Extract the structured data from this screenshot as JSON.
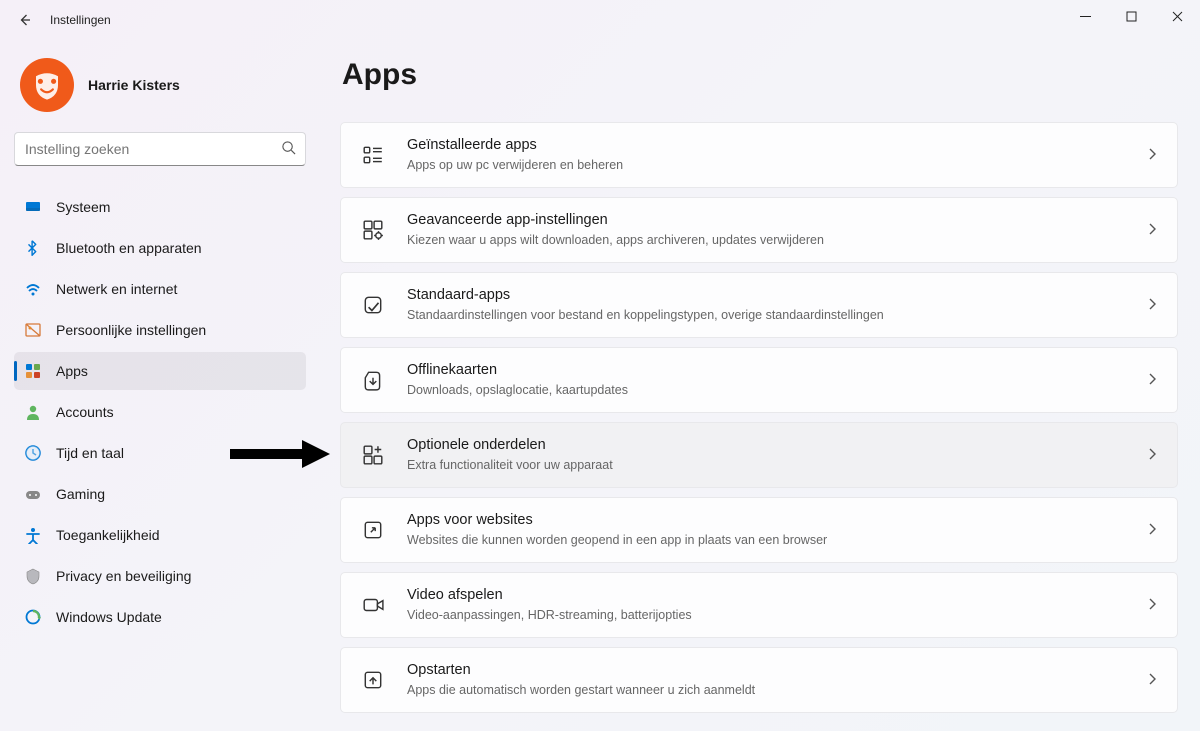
{
  "window": {
    "title": "Instellingen"
  },
  "profile": {
    "name": "Harrie Kisters"
  },
  "search": {
    "placeholder": "Instelling zoeken"
  },
  "nav": [
    {
      "icon": "system",
      "label": "Systeem",
      "active": false
    },
    {
      "icon": "bluetooth",
      "label": "Bluetooth en apparaten",
      "active": false
    },
    {
      "icon": "network",
      "label": "Netwerk en internet",
      "active": false
    },
    {
      "icon": "personal",
      "label": "Persoonlijke instellingen",
      "active": false
    },
    {
      "icon": "apps",
      "label": "Apps",
      "active": true
    },
    {
      "icon": "accounts",
      "label": "Accounts",
      "active": false
    },
    {
      "icon": "time",
      "label": "Tijd en taal",
      "active": false
    },
    {
      "icon": "gaming",
      "label": "Gaming",
      "active": false
    },
    {
      "icon": "access",
      "label": "Toegankelijkheid",
      "active": false
    },
    {
      "icon": "privacy",
      "label": "Privacy en beveiliging",
      "active": false
    },
    {
      "icon": "update",
      "label": "Windows Update",
      "active": false
    }
  ],
  "page": {
    "title": "Apps"
  },
  "cards": [
    {
      "title": "Geïnstalleerde apps",
      "sub": "Apps op uw pc verwijderen en beheren",
      "highlighted": false
    },
    {
      "title": "Geavanceerde app-instellingen",
      "sub": "Kiezen waar u apps wilt downloaden, apps archiveren, updates verwijderen",
      "highlighted": false
    },
    {
      "title": "Standaard-apps",
      "sub": "Standaardinstellingen voor bestand en koppelingstypen, overige standaardinstellingen",
      "highlighted": false
    },
    {
      "title": "Offlinekaarten",
      "sub": "Downloads, opslaglocatie, kaartupdates",
      "highlighted": false
    },
    {
      "title": "Optionele onderdelen",
      "sub": "Extra functionaliteit voor uw apparaat",
      "highlighted": true
    },
    {
      "title": "Apps voor websites",
      "sub": "Websites die kunnen worden geopend in een app in plaats van een browser",
      "highlighted": false
    },
    {
      "title": "Video afspelen",
      "sub": "Video-aanpassingen, HDR-streaming, batterijopties",
      "highlighted": false
    },
    {
      "title": "Opstarten",
      "sub": "Apps die automatisch worden gestart wanneer u zich aanmeldt",
      "highlighted": false
    }
  ]
}
